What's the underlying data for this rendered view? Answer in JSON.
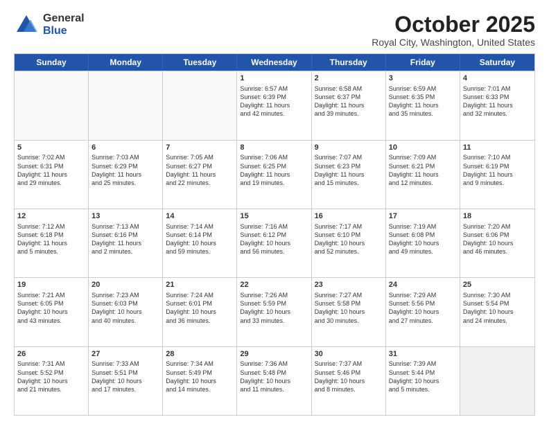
{
  "logo": {
    "general": "General",
    "blue": "Blue"
  },
  "header": {
    "month": "October 2025",
    "location": "Royal City, Washington, United States"
  },
  "weekdays": [
    "Sunday",
    "Monday",
    "Tuesday",
    "Wednesday",
    "Thursday",
    "Friday",
    "Saturday"
  ],
  "rows": [
    [
      {
        "day": "",
        "text": "",
        "empty": true
      },
      {
        "day": "",
        "text": "",
        "empty": true
      },
      {
        "day": "",
        "text": "",
        "empty": true
      },
      {
        "day": "1",
        "text": "Sunrise: 6:57 AM\nSunset: 6:39 PM\nDaylight: 11 hours\nand 42 minutes."
      },
      {
        "day": "2",
        "text": "Sunrise: 6:58 AM\nSunset: 6:37 PM\nDaylight: 11 hours\nand 39 minutes."
      },
      {
        "day": "3",
        "text": "Sunrise: 6:59 AM\nSunset: 6:35 PM\nDaylight: 11 hours\nand 35 minutes."
      },
      {
        "day": "4",
        "text": "Sunrise: 7:01 AM\nSunset: 6:33 PM\nDaylight: 11 hours\nand 32 minutes."
      }
    ],
    [
      {
        "day": "5",
        "text": "Sunrise: 7:02 AM\nSunset: 6:31 PM\nDaylight: 11 hours\nand 29 minutes."
      },
      {
        "day": "6",
        "text": "Sunrise: 7:03 AM\nSunset: 6:29 PM\nDaylight: 11 hours\nand 25 minutes."
      },
      {
        "day": "7",
        "text": "Sunrise: 7:05 AM\nSunset: 6:27 PM\nDaylight: 11 hours\nand 22 minutes."
      },
      {
        "day": "8",
        "text": "Sunrise: 7:06 AM\nSunset: 6:25 PM\nDaylight: 11 hours\nand 19 minutes."
      },
      {
        "day": "9",
        "text": "Sunrise: 7:07 AM\nSunset: 6:23 PM\nDaylight: 11 hours\nand 15 minutes."
      },
      {
        "day": "10",
        "text": "Sunrise: 7:09 AM\nSunset: 6:21 PM\nDaylight: 11 hours\nand 12 minutes."
      },
      {
        "day": "11",
        "text": "Sunrise: 7:10 AM\nSunset: 6:19 PM\nDaylight: 11 hours\nand 9 minutes."
      }
    ],
    [
      {
        "day": "12",
        "text": "Sunrise: 7:12 AM\nSunset: 6:18 PM\nDaylight: 11 hours\nand 5 minutes."
      },
      {
        "day": "13",
        "text": "Sunrise: 7:13 AM\nSunset: 6:16 PM\nDaylight: 11 hours\nand 2 minutes."
      },
      {
        "day": "14",
        "text": "Sunrise: 7:14 AM\nSunset: 6:14 PM\nDaylight: 10 hours\nand 59 minutes."
      },
      {
        "day": "15",
        "text": "Sunrise: 7:16 AM\nSunset: 6:12 PM\nDaylight: 10 hours\nand 56 minutes."
      },
      {
        "day": "16",
        "text": "Sunrise: 7:17 AM\nSunset: 6:10 PM\nDaylight: 10 hours\nand 52 minutes."
      },
      {
        "day": "17",
        "text": "Sunrise: 7:19 AM\nSunset: 6:08 PM\nDaylight: 10 hours\nand 49 minutes."
      },
      {
        "day": "18",
        "text": "Sunrise: 7:20 AM\nSunset: 6:06 PM\nDaylight: 10 hours\nand 46 minutes."
      }
    ],
    [
      {
        "day": "19",
        "text": "Sunrise: 7:21 AM\nSunset: 6:05 PM\nDaylight: 10 hours\nand 43 minutes."
      },
      {
        "day": "20",
        "text": "Sunrise: 7:23 AM\nSunset: 6:03 PM\nDaylight: 10 hours\nand 40 minutes."
      },
      {
        "day": "21",
        "text": "Sunrise: 7:24 AM\nSunset: 6:01 PM\nDaylight: 10 hours\nand 36 minutes."
      },
      {
        "day": "22",
        "text": "Sunrise: 7:26 AM\nSunset: 5:59 PM\nDaylight: 10 hours\nand 33 minutes."
      },
      {
        "day": "23",
        "text": "Sunrise: 7:27 AM\nSunset: 5:58 PM\nDaylight: 10 hours\nand 30 minutes."
      },
      {
        "day": "24",
        "text": "Sunrise: 7:29 AM\nSunset: 5:56 PM\nDaylight: 10 hours\nand 27 minutes."
      },
      {
        "day": "25",
        "text": "Sunrise: 7:30 AM\nSunset: 5:54 PM\nDaylight: 10 hours\nand 24 minutes."
      }
    ],
    [
      {
        "day": "26",
        "text": "Sunrise: 7:31 AM\nSunset: 5:52 PM\nDaylight: 10 hours\nand 21 minutes."
      },
      {
        "day": "27",
        "text": "Sunrise: 7:33 AM\nSunset: 5:51 PM\nDaylight: 10 hours\nand 17 minutes."
      },
      {
        "day": "28",
        "text": "Sunrise: 7:34 AM\nSunset: 5:49 PM\nDaylight: 10 hours\nand 14 minutes."
      },
      {
        "day": "29",
        "text": "Sunrise: 7:36 AM\nSunset: 5:48 PM\nDaylight: 10 hours\nand 11 minutes."
      },
      {
        "day": "30",
        "text": "Sunrise: 7:37 AM\nSunset: 5:46 PM\nDaylight: 10 hours\nand 8 minutes."
      },
      {
        "day": "31",
        "text": "Sunrise: 7:39 AM\nSunset: 5:44 PM\nDaylight: 10 hours\nand 5 minutes."
      },
      {
        "day": "",
        "text": "",
        "empty": true,
        "shaded": true
      }
    ]
  ]
}
